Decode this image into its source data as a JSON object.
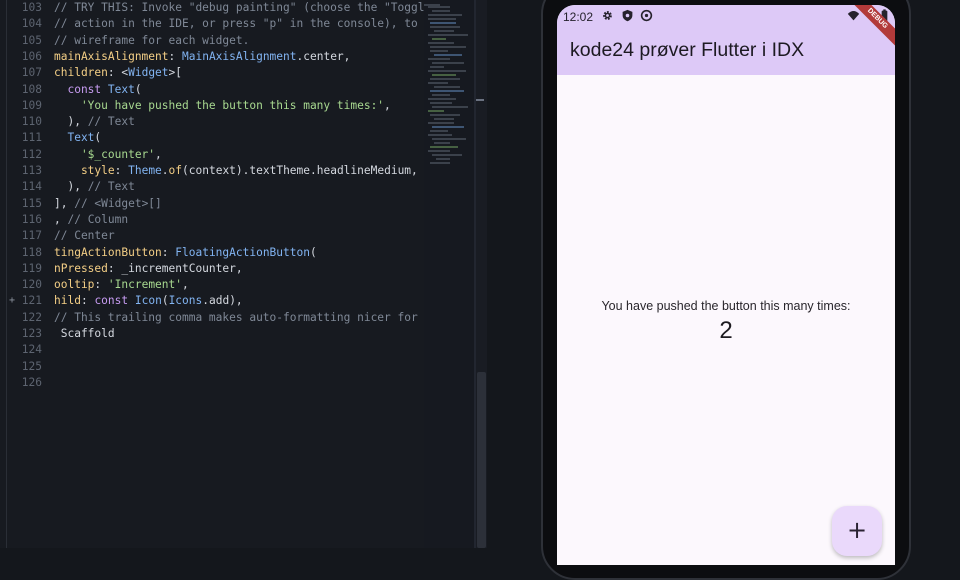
{
  "editor": {
    "lines": [
      {
        "num": "103",
        "tokens": [
          {
            "t": "// TRY THIS: Invoke \"debug painting\" (choose the \"Toggle",
            "c": "comment"
          }
        ]
      },
      {
        "num": "104",
        "tokens": [
          {
            "t": "// action in the IDE, or press \"p\" in the console), to s",
            "c": "comment"
          }
        ]
      },
      {
        "num": "105",
        "tokens": [
          {
            "t": "// wireframe for each widget.",
            "c": "comment"
          }
        ]
      },
      {
        "num": "106",
        "tokens": [
          {
            "t": "mainAxisAlignment",
            "c": "prop"
          },
          {
            "t": ": ",
            "c": "plain"
          },
          {
            "t": "MainAxisAlignment",
            "c": "class"
          },
          {
            "t": ".center,",
            "c": "plain"
          }
        ]
      },
      {
        "num": "107",
        "tokens": [
          {
            "t": "children",
            "c": "prop"
          },
          {
            "t": ": <",
            "c": "plain"
          },
          {
            "t": "Widget",
            "c": "class"
          },
          {
            "t": ">[",
            "c": "plain"
          }
        ]
      },
      {
        "num": "108",
        "tokens": [
          {
            "t": "  const ",
            "c": "keyword"
          },
          {
            "t": "Text",
            "c": "class"
          },
          {
            "t": "(",
            "c": "plain"
          }
        ]
      },
      {
        "num": "109",
        "tokens": [
          {
            "t": "    'You have pushed the button this many times:'",
            "c": "string"
          },
          {
            "t": ",",
            "c": "plain"
          }
        ]
      },
      {
        "num": "110",
        "tokens": [
          {
            "t": "  ), ",
            "c": "plain"
          },
          {
            "t": "// Text",
            "c": "comment"
          }
        ]
      },
      {
        "num": "111",
        "tokens": [
          {
            "t": "  Text",
            "c": "class"
          },
          {
            "t": "(",
            "c": "plain"
          }
        ]
      },
      {
        "num": "112",
        "tokens": [
          {
            "t": "    '$_counter'",
            "c": "string"
          },
          {
            "t": ",",
            "c": "plain"
          }
        ]
      },
      {
        "num": "113",
        "tokens": [
          {
            "t": "    style",
            "c": "prop"
          },
          {
            "t": ": ",
            "c": "plain"
          },
          {
            "t": "Theme",
            "c": "class"
          },
          {
            "t": ".",
            "c": "plain"
          },
          {
            "t": "of",
            "c": "prop"
          },
          {
            "t": "(context).textTheme.headlineMedium,",
            "c": "plain"
          }
        ]
      },
      {
        "num": "114",
        "tokens": [
          {
            "t": "  ), ",
            "c": "plain"
          },
          {
            "t": "// Text",
            "c": "comment"
          }
        ]
      },
      {
        "num": "115",
        "tokens": [
          {
            "t": "], ",
            "c": "plain"
          },
          {
            "t": "// <Widget>[]",
            "c": "comment"
          }
        ]
      },
      {
        "num": "116",
        "tokens": [
          {
            "t": ", ",
            "c": "plain"
          },
          {
            "t": "// Column",
            "c": "comment"
          }
        ]
      },
      {
        "num": "117",
        "tokens": [
          {
            "t": "// Center",
            "c": "comment"
          }
        ]
      },
      {
        "num": "118",
        "tokens": [
          {
            "t": "tingActionButton",
            "c": "prop"
          },
          {
            "t": ": ",
            "c": "plain"
          },
          {
            "t": "FloatingActionButton",
            "c": "class"
          },
          {
            "t": "(",
            "c": "plain"
          }
        ]
      },
      {
        "num": "119",
        "tokens": [
          {
            "t": "nPressed",
            "c": "prop"
          },
          {
            "t": ": _incrementCounter,",
            "c": "plain"
          }
        ]
      },
      {
        "num": "120",
        "tokens": [
          {
            "t": "ooltip",
            "c": "prop"
          },
          {
            "t": ": ",
            "c": "plain"
          },
          {
            "t": "'Increment'",
            "c": "string"
          },
          {
            "t": ",",
            "c": "plain"
          }
        ]
      },
      {
        "num": "121",
        "gutter": "+",
        "tokens": [
          {
            "t": "hild",
            "c": "prop"
          },
          {
            "t": ": ",
            "c": "plain"
          },
          {
            "t": "const ",
            "c": "keyword"
          },
          {
            "t": "Icon",
            "c": "class"
          },
          {
            "t": "(",
            "c": "plain"
          },
          {
            "t": "Icons",
            "c": "class"
          },
          {
            "t": ".add),",
            "c": "plain"
          }
        ]
      },
      {
        "num": "122",
        "tokens": [
          {
            "t": "// This trailing comma makes auto-formatting nicer for bu",
            "c": "comment"
          }
        ]
      },
      {
        "num": "123",
        "tokens": [
          {
            "t": " Scaffold",
            "c": "plain"
          }
        ]
      },
      {
        "num": "124",
        "tokens": []
      },
      {
        "num": "125",
        "tokens": []
      },
      {
        "num": "126",
        "tokens": []
      }
    ]
  },
  "preview": {
    "status_bar": {
      "time": "12:02",
      "icons": [
        "gear-icon",
        "shield-icon",
        "sync-icon"
      ],
      "right_icons": [
        "wifi-icon",
        "battery-icon"
      ]
    },
    "app_bar": {
      "title": "kode24 prøver Flutter i IDX"
    },
    "debug_banner": "DEBUG",
    "body": {
      "label": "You have pushed the button this many times:",
      "counter": "2"
    },
    "fab": {
      "icon": "add-icon",
      "symbol": "+"
    }
  },
  "colors": {
    "app_bar": "#ddc9f7",
    "screen_bg": "#fcf8fd",
    "fab": "#ead9fb",
    "editor_bg": "#171a20",
    "debug_banner": "#b23a3a"
  }
}
